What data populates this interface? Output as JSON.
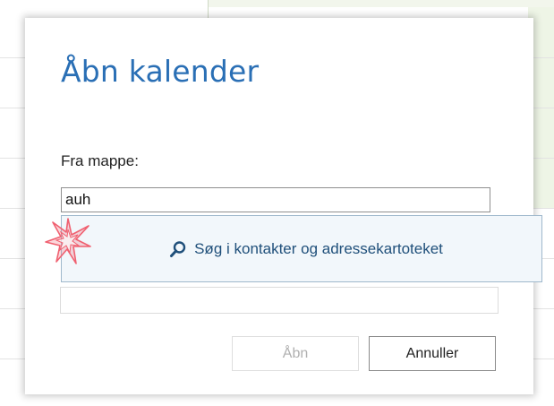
{
  "dialog": {
    "title": "Åbn kalender",
    "field_label": "Fra mappe:",
    "folder_input_value": "auh",
    "open_button": "Åbn",
    "cancel_button": "Annuller"
  },
  "suggestion": {
    "label": "Søg i kontakter og adressekartoteket",
    "icon": "search-icon"
  },
  "marker": {
    "icon": "click-star-icon",
    "color": "#f06070"
  },
  "colors": {
    "title": "#2a6fb5",
    "suggestion_bg": "#f2f7fb",
    "suggestion_text": "#1f4f7a"
  }
}
